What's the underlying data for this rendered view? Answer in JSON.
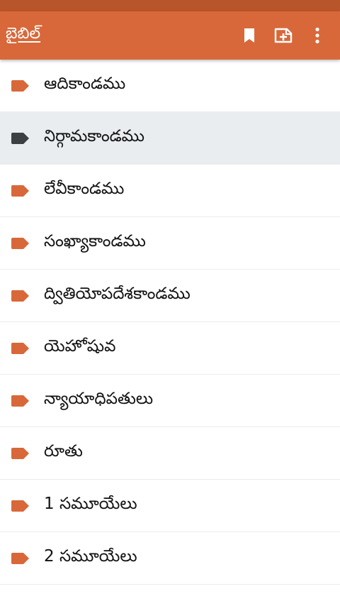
{
  "app_bar": {
    "title": "బైబిల్",
    "icons": [
      "bookmark-icon",
      "add-note-icon",
      "more-vert-icon"
    ]
  },
  "colors": {
    "status_bar": "#b9552a",
    "app_bar": "#d8683a",
    "tag_accent": "#d8683a",
    "tag_selected": "#3d4043",
    "selected_row": "#e9edf0"
  },
  "books": [
    {
      "name": "ఆదికాండము",
      "selected": false
    },
    {
      "name": "నిర్గామకాండము",
      "selected": true
    },
    {
      "name": "లేవీకాండము",
      "selected": false
    },
    {
      "name": "సంఖ్యాకాండము",
      "selected": false
    },
    {
      "name": "ద్వితియోపదేశకాండము",
      "selected": false
    },
    {
      "name": "యెహోషువ",
      "selected": false
    },
    {
      "name": "న్యాయాధిపతులు",
      "selected": false
    },
    {
      "name": "రూతు",
      "selected": false
    },
    {
      "name": "1 సమూయేలు",
      "selected": false
    },
    {
      "name": "2 సమూయేలు",
      "selected": false
    }
  ]
}
